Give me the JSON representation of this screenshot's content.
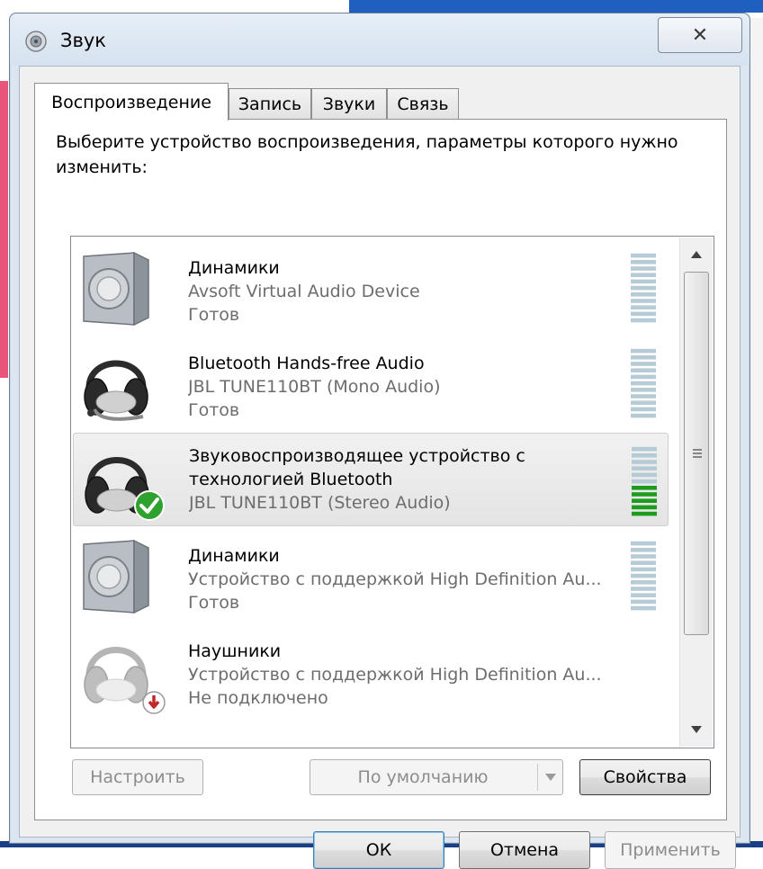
{
  "window": {
    "title": "Звук",
    "close_glyph": "✕"
  },
  "tabs": [
    {
      "label": "Воспроизведение",
      "active": true
    },
    {
      "label": "Запись",
      "active": false
    },
    {
      "label": "Звуки",
      "active": false
    },
    {
      "label": "Связь",
      "active": false
    }
  ],
  "instruction": "Выберите устройство воспроизведения, параметры которого нужно изменить:",
  "devices": [
    {
      "name": "Динамики",
      "description": "Avsoft Virtual Audio Device",
      "status": "Готов",
      "icon": "speaker-icon",
      "selected": false,
      "default": false
    },
    {
      "name": "Bluetooth Hands-free Audio",
      "description": "JBL TUNE110BT (Mono Audio)",
      "status": "Готов",
      "icon": "headset-icon",
      "selected": false,
      "default": false
    },
    {
      "name": "Звуковоспроизводящее устройство с",
      "name_line2": "технологией Bluetooth",
      "description": "JBL TUNE110BT (Stereo Audio)",
      "status": "",
      "icon": "headphones-icon",
      "selected": true,
      "default": true,
      "level_fraction": 0.45
    },
    {
      "name": "Динамики",
      "description": "Устройство с поддержкой High Definition Au...",
      "status": "Готов",
      "icon": "speaker-icon",
      "selected": false,
      "default": false
    },
    {
      "name": "Наушники",
      "description": "Устройство с поддержкой High Definition Au...",
      "status": "Не подключено",
      "icon": "headphones-disconnected-icon",
      "selected": false,
      "default": false
    }
  ],
  "buttons": {
    "configure": "Настроить",
    "set_default": "По умолчанию",
    "properties": "Свойства",
    "ok": "ОК",
    "cancel": "Отмена",
    "apply": "Применить"
  },
  "colors": {
    "meter_idle": "#b7cbd6",
    "meter_active": "#1e9a1e",
    "default_check": "#2fa12f"
  }
}
